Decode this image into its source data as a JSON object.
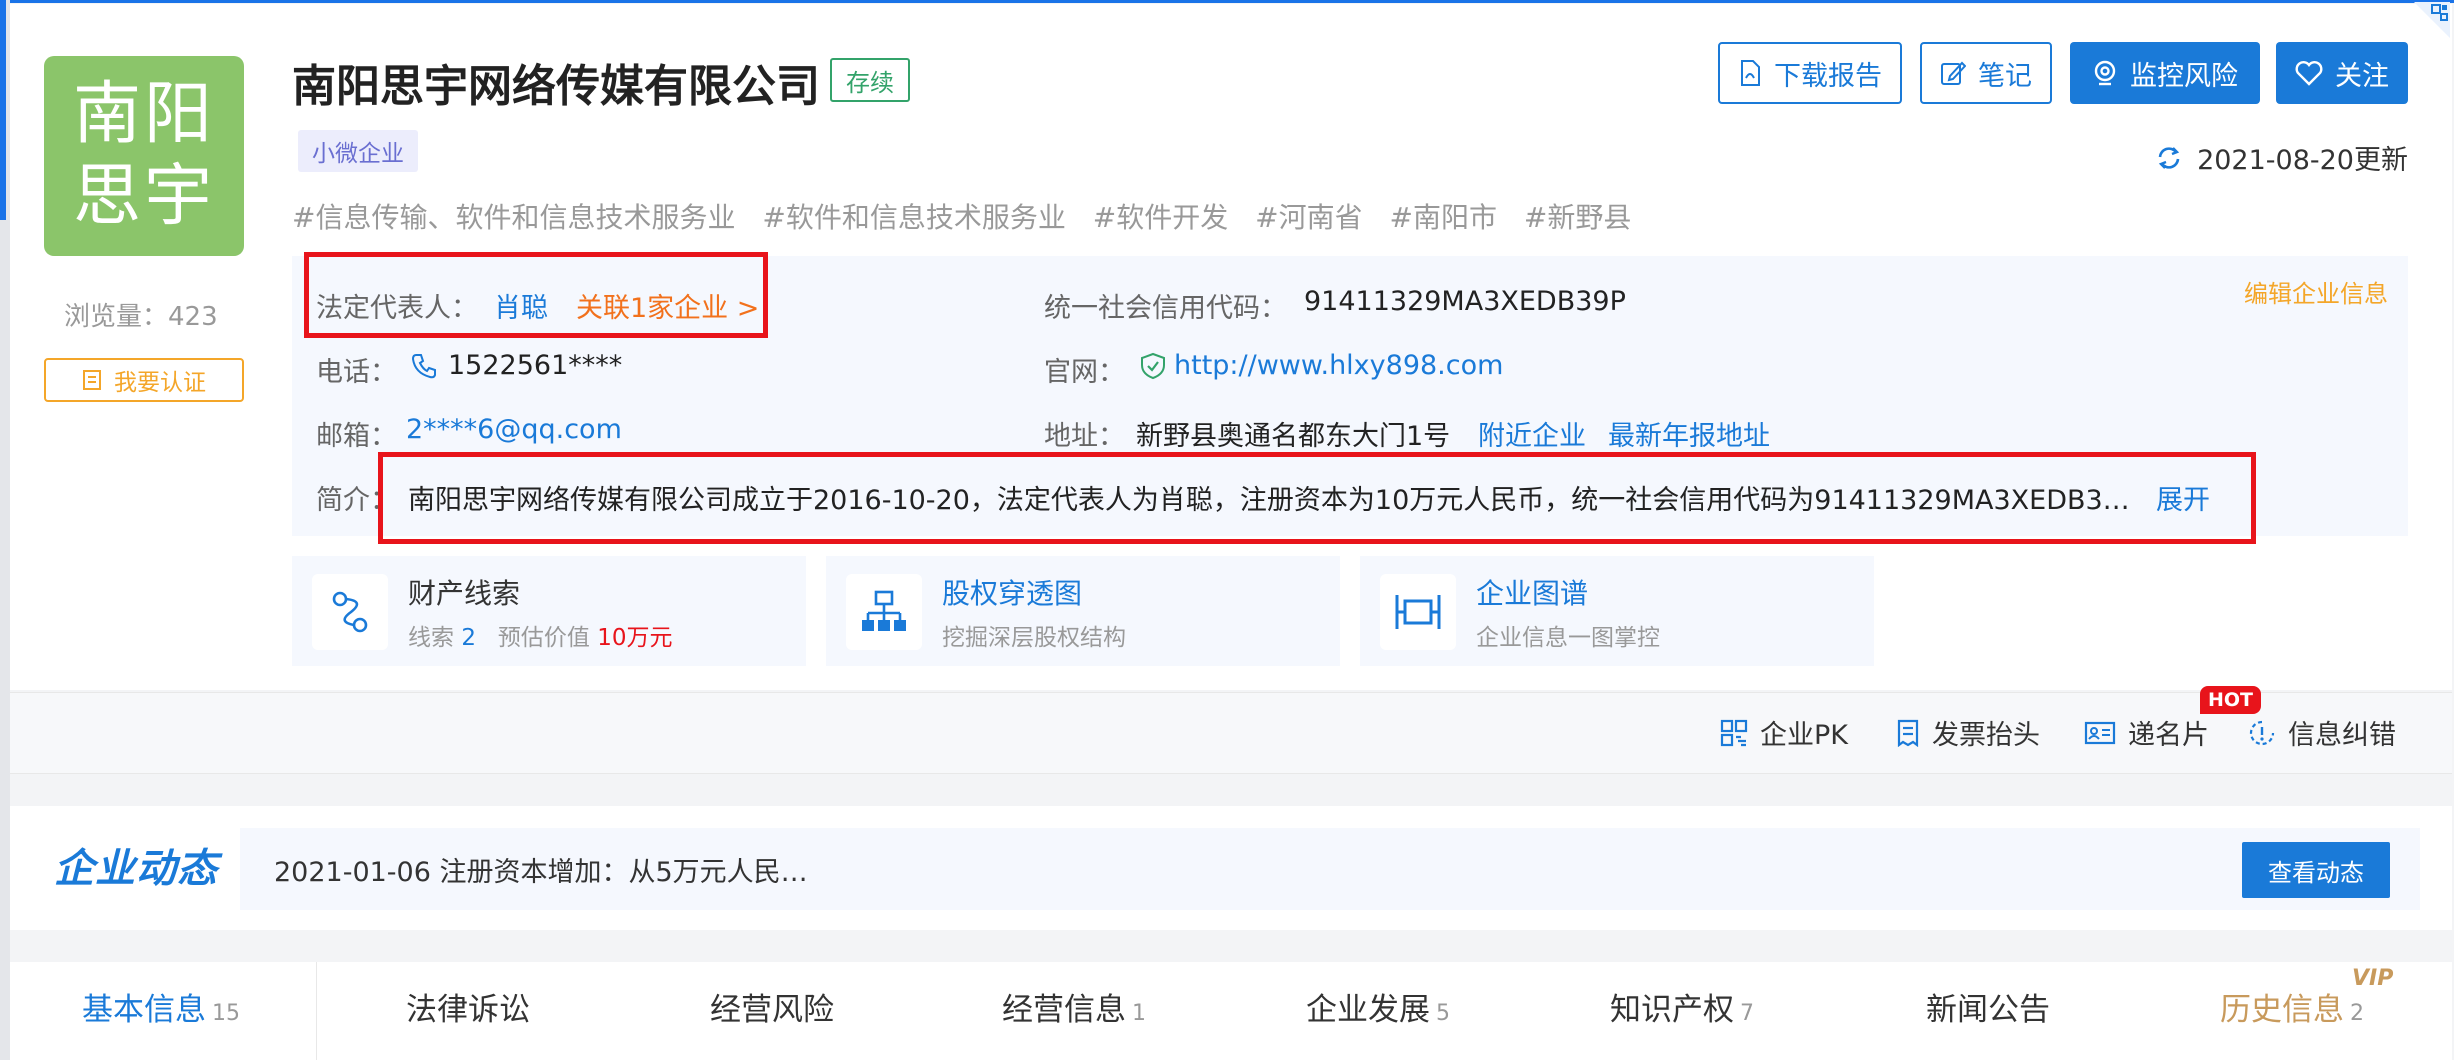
{
  "company": {
    "logo_line1": "南阳",
    "logo_line2": "思宇",
    "name": "南阳思宇网络传媒有限公司",
    "status": "存续",
    "size_tag": "小微企业",
    "industry_tags": [
      "#信息传输、软件和信息技术服务业",
      "#软件和信息技术服务业",
      "#软件开发",
      "#河南省",
      "#南阳市",
      "#新野县"
    ],
    "views_label": "浏览量：423",
    "certify_label": "我要认证"
  },
  "actions": {
    "download": "下载报告",
    "notes": "笔记",
    "monitor": "监控风险",
    "follow": "关注"
  },
  "update_text": "2021-08-20更新",
  "info": {
    "edit_label": "编辑企业信息",
    "legal_rep_label": "法定代表人：",
    "legal_rep": "肖聪",
    "related": "关联1家企业 >",
    "credit_label": "统一社会信用代码：",
    "credit_code": "91411329MA3XEDB39P",
    "phone_label": "电话：",
    "phone": "1522561****",
    "website_label": "官网：",
    "website": "http://www.hlxy898.com",
    "email_label": "邮箱：",
    "email": "2****6@qq.com",
    "address_label": "地址：",
    "address": "新野县奥通名都东大门1号",
    "nearby": "附近企业",
    "latest_addr": "最新年报地址",
    "intro_label": "简介：",
    "intro": "南阳思宇网络传媒有限公司成立于2016-10-20，法定代表人为肖聪，注册资本为10万元人民币，统一社会信用代码为91411329MA3XEDB3…",
    "expand": "展开"
  },
  "features": [
    {
      "title": "财产线索",
      "sub_label": "线索",
      "sub_count": "2",
      "sub_label2": "预估价值",
      "sub_value": "10万元"
    },
    {
      "title": "股权穿透图",
      "sub": "挖掘深层股权结构"
    },
    {
      "title": "企业图谱",
      "sub": "企业信息一图掌控"
    }
  ],
  "toolbar": {
    "pk": "企业PK",
    "invoice": "发票抬头",
    "card": "递名片",
    "hot": "HOT",
    "correct": "信息纠错"
  },
  "news": {
    "title": "企业动态",
    "text": "2021-01-06 注册资本增加：从5万元人民…",
    "button": "查看动态"
  },
  "tabs": [
    {
      "label": "基本信息",
      "count": "15"
    },
    {
      "label": "法律诉讼",
      "count": ""
    },
    {
      "label": "经营风险",
      "count": ""
    },
    {
      "label": "经营信息",
      "count": "1"
    },
    {
      "label": "企业发展",
      "count": "5"
    },
    {
      "label": "知识产权",
      "count": "7"
    },
    {
      "label": "新闻公告",
      "count": ""
    },
    {
      "label": "历史信息",
      "count": "2"
    }
  ],
  "vip_mark": "VIP",
  "colors": {
    "brand_blue": "#1a7ad8",
    "logo_green": "#8bc56a",
    "status_green": "#33a36a",
    "highlight_red": "#e8141b",
    "orange": "#f2711c",
    "gold": "#f4a629"
  }
}
